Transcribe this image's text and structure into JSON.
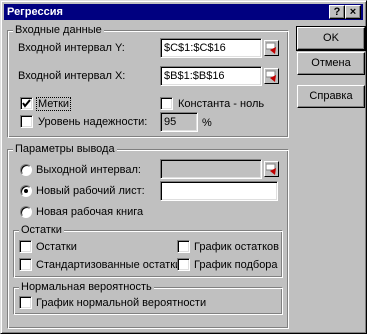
{
  "window": {
    "title": "Регрессия",
    "help_btn": "?",
    "close_btn": "×"
  },
  "input_group": {
    "legend": "Входные данные",
    "y_label": "Входной интервал Y:",
    "y_value": "$C$1:$C$16",
    "x_label": "Входной интервал X:",
    "x_value": "$B$1:$B$16",
    "labels_checkbox": {
      "label": "Метки",
      "checked": true
    },
    "constant_checkbox": {
      "label": "Константа - ноль",
      "checked": false
    },
    "confidence_checkbox": {
      "label": "Уровень надежности:",
      "checked": false
    },
    "confidence_value": "95",
    "confidence_unit": "%"
  },
  "output_group": {
    "legend": "Параметры вывода",
    "output_range_radio": {
      "label": "Выходной интервал:",
      "selected": false
    },
    "output_range_value": "",
    "new_sheet_radio": {
      "label": "Новый рабочий лист:",
      "selected": true
    },
    "new_sheet_value": "",
    "new_workbook_radio": {
      "label": "Новая рабочая книга",
      "selected": false
    }
  },
  "residuals_group": {
    "legend": "Остатки",
    "residuals": {
      "label": "Остатки",
      "checked": false
    },
    "standardized": {
      "label": "Стандартизованные остатки",
      "checked": false
    },
    "residual_plot": {
      "label": "График остатков",
      "checked": false
    },
    "fit_plot": {
      "label": "График подбора",
      "checked": false
    }
  },
  "normal_group": {
    "legend": "Нормальная вероятность",
    "normal_plot": {
      "label": "График нормальной вероятности",
      "checked": false
    }
  },
  "buttons": {
    "ok": "OK",
    "cancel": "Отмена",
    "help": "Справка"
  }
}
